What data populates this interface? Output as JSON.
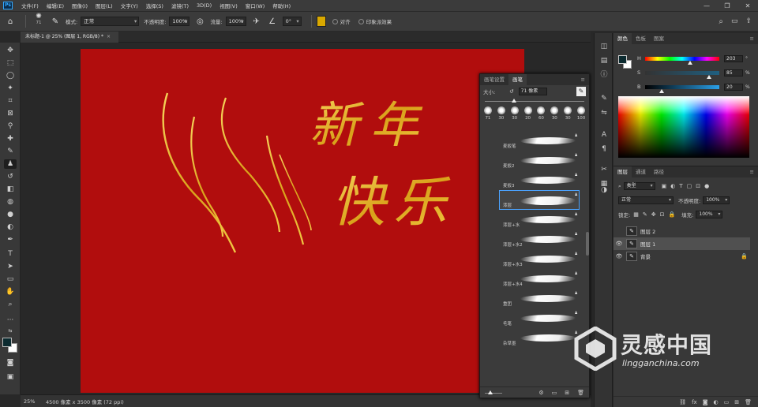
{
  "menubar": {
    "app_icon": "Ps",
    "items": [
      "文件(F)",
      "编辑(E)",
      "图像(I)",
      "图层(L)",
      "文字(Y)",
      "选择(S)",
      "滤镜(T)",
      "3D(D)",
      "视图(V)",
      "窗口(W)",
      "帮助(H)"
    ],
    "controls": [
      "—",
      "❐",
      "✕"
    ]
  },
  "options": {
    "brush_size": "71",
    "mode_label": "模式:",
    "mode_value": "正常",
    "opacity_label": "不透明度:",
    "opacity_value": "100%",
    "flow_label": "流量:",
    "flow_value": "100%",
    "angle_value": "0°",
    "brush_color": "#d9a800",
    "align_label": "对齐",
    "sample_label": "印象派效果"
  },
  "document": {
    "tab_title": "未标题-1 @ 25% (图层 1, RGB/8) *",
    "close": "×",
    "canvas_color": "#b10d0d",
    "art_text_1": "新年",
    "art_text_2": "快乐"
  },
  "status": {
    "zoom": "25%",
    "doc_info": "4500 像素 x 3500 像素 (72 ppi)"
  },
  "brush_panel": {
    "tabs": [
      "画笔设置",
      "画笔"
    ],
    "size_label": "大小:",
    "size_value": "71 像素",
    "presets": [
      "71",
      "30",
      "30",
      "20",
      "60",
      "30",
      "30",
      "100"
    ],
    "items": [
      {
        "name": "麦扳笔",
        "selected": false
      },
      {
        "name": "麦扳2",
        "selected": false
      },
      {
        "name": "麦扳3",
        "selected": false
      },
      {
        "name": "漆层",
        "selected": true
      },
      {
        "name": "漆层+水",
        "selected": false
      },
      {
        "name": "漆层+水2",
        "selected": false
      },
      {
        "name": "漆层+水3",
        "selected": false
      },
      {
        "name": "漆层+水4",
        "selected": false
      },
      {
        "name": "重团",
        "selected": false
      },
      {
        "name": "毛笔",
        "selected": false
      },
      {
        "name": "杂草墨",
        "selected": false
      }
    ]
  },
  "color_panel": {
    "tabs": [
      "颜色",
      "色板",
      "图案"
    ],
    "h_label": "H",
    "h_value": "203",
    "s_label": "S",
    "s_value": "85",
    "b_label": "B",
    "b_value": "20",
    "units": [
      "°",
      "%",
      "%"
    ]
  },
  "layers_panel": {
    "tabs": [
      "图层",
      "通道",
      "路径"
    ],
    "filter_value": "类型",
    "blend_value": "正常",
    "opacity_label": "不透明度:",
    "opacity_value": "100%",
    "lock_label": "锁定:",
    "fill_label": "填充:",
    "fill_value": "100%",
    "layers": [
      {
        "name": "图层 2",
        "selected": false,
        "visible": false
      },
      {
        "name": "图层 1",
        "selected": true,
        "visible": true
      },
      {
        "name": "背景",
        "selected": false,
        "visible": true
      }
    ]
  },
  "watermark": {
    "title": "灵感中国",
    "url": "lingganchina.com"
  }
}
